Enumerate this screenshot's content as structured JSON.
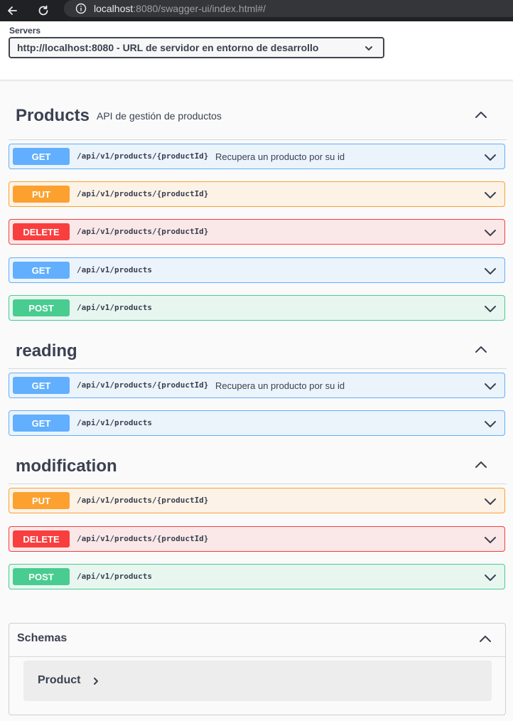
{
  "browser": {
    "url_host": "localhost",
    "url_rest": ":8080/swagger-ui/index.html#/"
  },
  "servers": {
    "label": "Servers",
    "selected": "http://localhost:8080 - URL de servidor en entorno de desarrollo"
  },
  "tags": [
    {
      "name": "Products",
      "description": "API de gestión de productos",
      "operations": [
        {
          "method": "GET",
          "path": "/api/v1/products/{productId}",
          "summary": "Recupera un producto por su id"
        },
        {
          "method": "PUT",
          "path": "/api/v1/products/{productId}",
          "summary": ""
        },
        {
          "method": "DELETE",
          "path": "/api/v1/products/{productId}",
          "summary": ""
        },
        {
          "method": "GET",
          "path": "/api/v1/products",
          "summary": ""
        },
        {
          "method": "POST",
          "path": "/api/v1/products",
          "summary": ""
        }
      ]
    },
    {
      "name": "reading",
      "description": "",
      "operations": [
        {
          "method": "GET",
          "path": "/api/v1/products/{productId}",
          "summary": "Recupera un producto por su id"
        },
        {
          "method": "GET",
          "path": "/api/v1/products",
          "summary": ""
        }
      ]
    },
    {
      "name": "modification",
      "description": "",
      "operations": [
        {
          "method": "PUT",
          "path": "/api/v1/products/{productId}",
          "summary": ""
        },
        {
          "method": "DELETE",
          "path": "/api/v1/products/{productId}",
          "summary": ""
        },
        {
          "method": "POST",
          "path": "/api/v1/products",
          "summary": ""
        }
      ]
    }
  ],
  "schemas": {
    "title": "Schemas",
    "models": [
      {
        "name": "Product"
      }
    ]
  },
  "colors": {
    "get": "#61affe",
    "put": "#fca130",
    "delete": "#f93e3e",
    "post": "#49cc90",
    "text": "#3b4151"
  },
  "icons": {
    "back": "arrow-left-icon",
    "reload": "reload-icon",
    "info": "info-icon",
    "expand": "chevron-down-icon",
    "collapse": "chevron-up-icon",
    "model_expand": "chevron-right-icon"
  }
}
